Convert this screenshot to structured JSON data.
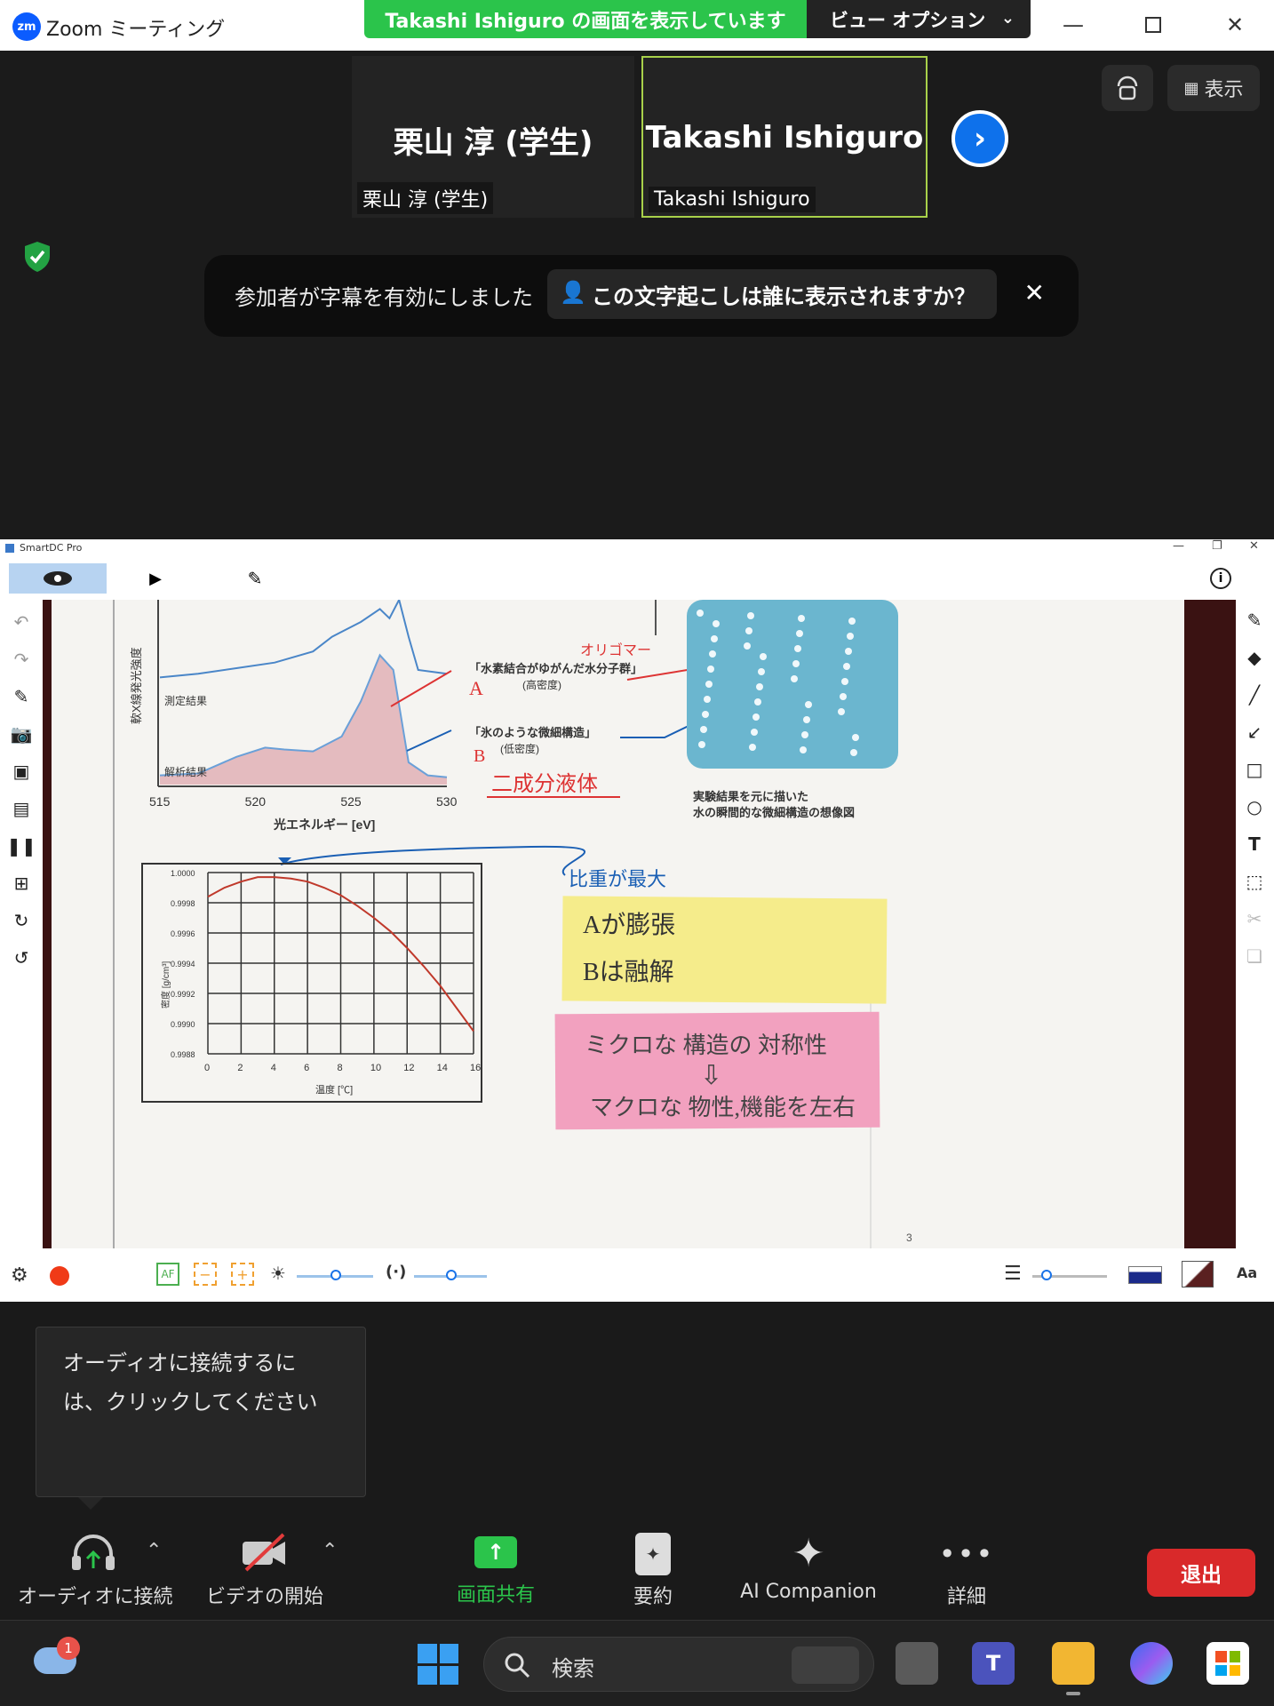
{
  "titlebar": {
    "app_title": "Zoom ミーティング",
    "logo_text": "zm",
    "share_banner": "Takashi  Ishiguro の画面を表示しています",
    "view_options": "ビュー オプション"
  },
  "participants": [
    {
      "big_name": "栗山 淳 (学生)",
      "label": "栗山 淳 (学生)"
    },
    {
      "big_name": "Takashi Ishiguro",
      "label": "Takashi Ishiguro"
    }
  ],
  "view_button": "表示",
  "caption_banner": {
    "text": "参加者が字幕を有効にしました",
    "question": "この文字起こしは誰に表示されますか？"
  },
  "smartdc": {
    "title": "SmartDC Pro",
    "page_number": "3"
  },
  "chart_data": [
    {
      "type": "line",
      "title": "",
      "xlabel": "光エネルギー [eV]",
      "ylabel": "軟X線発光強度",
      "x_ticks": [
        "515",
        "520",
        "525",
        "530"
      ],
      "series": [
        {
          "name": "測定結果",
          "x": [
            515,
            517,
            519,
            521,
            523,
            524,
            525.5,
            526.5,
            527,
            527.5,
            528,
            528.5,
            530
          ],
          "y": [
            0.58,
            0.6,
            0.63,
            0.66,
            0.72,
            0.8,
            0.88,
            0.95,
            0.9,
            1.0,
            0.8,
            0.62,
            0.6
          ]
        },
        {
          "name": "解析結果",
          "x": [
            515,
            517,
            519,
            520.5,
            521.5,
            523,
            524.5,
            525.5,
            526.5,
            527.2,
            528,
            529,
            530
          ],
          "y": [
            0.05,
            0.06,
            0.15,
            0.2,
            0.19,
            0.18,
            0.26,
            0.45,
            0.7,
            0.62,
            0.12,
            0.05,
            0.04
          ]
        }
      ]
    },
    {
      "type": "line",
      "title": "",
      "xlabel": "温度 [℃]",
      "ylabel": "密度 [g/cm³]",
      "x_ticks": [
        "0",
        "2",
        "4",
        "6",
        "8",
        "10",
        "12",
        "14",
        "16"
      ],
      "y_ticks": [
        "1.0000",
        "0.9998",
        "0.9996",
        "0.9994",
        "0.9992",
        "0.9990",
        "0.9988"
      ],
      "xlim": [
        0,
        16
      ],
      "ylim": [
        0.9988,
        1.0
      ],
      "grid": true,
      "series": [
        {
          "name": "",
          "x": [
            0,
            1,
            2,
            3,
            4,
            5,
            6,
            7,
            8,
            9,
            10,
            11,
            12,
            13,
            14,
            15,
            16
          ],
          "y": [
            0.99984,
            0.9999,
            0.99994,
            0.99997,
            0.99997,
            0.99996,
            0.99994,
            0.9999,
            0.99985,
            0.99978,
            0.9997,
            0.99961,
            0.9995,
            0.99938,
            0.99925,
            0.9991,
            0.99895
          ]
        }
      ]
    }
  ],
  "slide": {
    "label_A_text": "「水素結合がゆがんだ水分子群」",
    "label_A_sub": "(高密度)",
    "label_A_letter": "A",
    "label_B_text": "「氷のような微細構造」",
    "label_B_sub": "(低密度)",
    "label_B_letter": "B",
    "oligomer": "オリゴマー",
    "two_component": "二成分液体",
    "illustration_caption_1": "実験結果を元に描いた",
    "illustration_caption_2": "水の瞬間的な微細構造の想像図",
    "max_density_note": "比重が最大",
    "yellow_note_1": "Aが膨張",
    "yellow_note_2": "Bは融解",
    "pink_note_1": "ミクロな 構造の 対称性",
    "pink_arrow": "⇩",
    "pink_note_2": "マクロな 物性,機能を左右"
  },
  "tooltip": {
    "line1": "オーディオに接続するに",
    "line2": "は、クリックしてください"
  },
  "controls": {
    "audio": "オーディオに接続",
    "video": "ビデオの開始",
    "share": "画面共有",
    "summary": "要約",
    "ai": "AI Companion",
    "more": "詳細",
    "leave": "退出"
  },
  "taskbar": {
    "search_placeholder": "検索",
    "badge": "1"
  },
  "colors": {
    "zoom_blue": "#0b5cff",
    "share_green": "#2bc44b",
    "leave_red": "#d9292a",
    "active_tile_border": "#a8d14a"
  }
}
